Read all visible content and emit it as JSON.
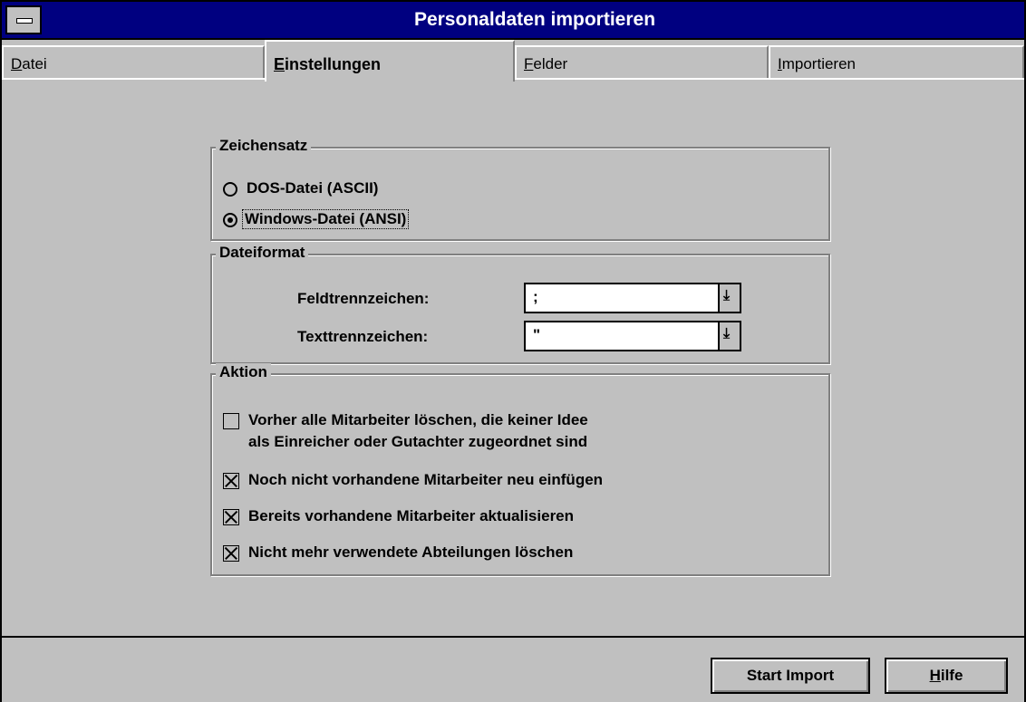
{
  "window": {
    "title": "Personaldaten importieren"
  },
  "tabs": [
    {
      "label_pre": "",
      "label_ul": "D",
      "label_post": "atei"
    },
    {
      "label_pre": "",
      "label_ul": "E",
      "label_post": "instellungen"
    },
    {
      "label_pre": "",
      "label_ul": "F",
      "label_post": "elder"
    },
    {
      "label_pre": "",
      "label_ul": "I",
      "label_post": "mportieren"
    }
  ],
  "zeichensatz": {
    "title": "Zeichensatz",
    "options": [
      {
        "label": "DOS-Datei (ASCII)",
        "selected": false
      },
      {
        "label": "Windows-Datei (ANSI)",
        "selected": true
      }
    ]
  },
  "dateiformat": {
    "title": "Dateiformat",
    "feld_label": "Feldtrennzeichen:",
    "feld_value": ";",
    "text_label": "Texttrennzeichen:",
    "text_value": "\"",
    "dropdown_glyph": "⤓"
  },
  "aktion": {
    "title": "Aktion",
    "items": [
      {
        "line1": "Vorher alle Mitarbeiter löschen, die keiner Idee",
        "line2": "als Einreicher oder Gutachter zugeordnet sind",
        "checked": false
      },
      {
        "line1": "Noch nicht vorhandene Mitarbeiter neu einfügen",
        "line2": "",
        "checked": true
      },
      {
        "line1": "Bereits vorhandene Mitarbeiter aktualisieren",
        "line2": "",
        "checked": true
      },
      {
        "line1": "Nicht mehr verwendete Abteilungen löschen",
        "line2": "",
        "checked": true
      }
    ]
  },
  "footer": {
    "start_label": "Start Import",
    "hilfe_ul": "H",
    "hilfe_rest": "ilfe"
  }
}
